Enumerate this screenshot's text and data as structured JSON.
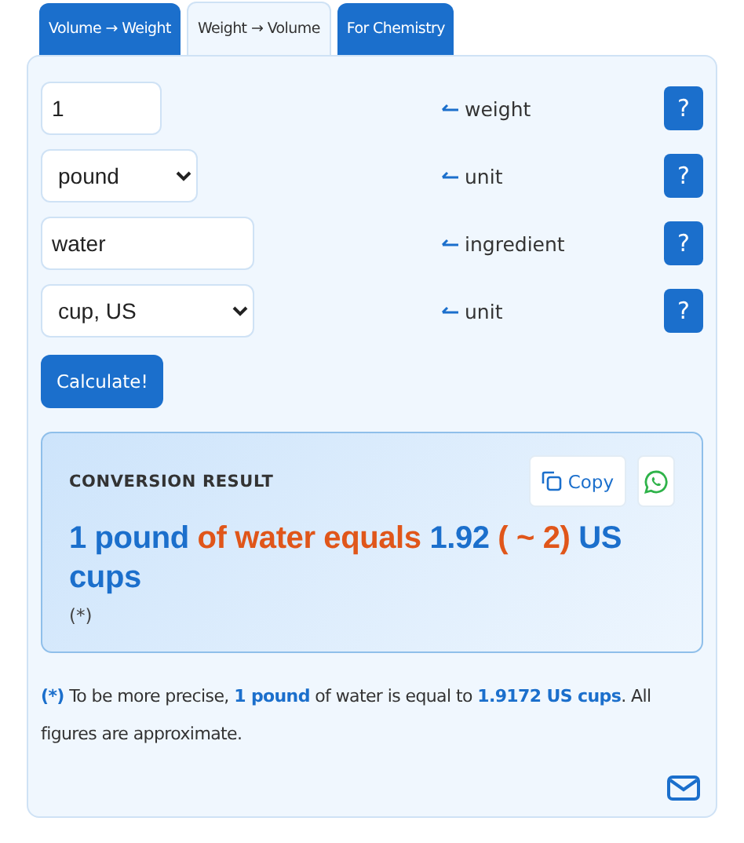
{
  "tabs": [
    {
      "label": "Volume → Weight",
      "selected": false
    },
    {
      "label": "Weight → Volume",
      "selected": true
    },
    {
      "label": "For Chemistry",
      "selected": false
    }
  ],
  "fields": [
    {
      "kind": "input",
      "value": "1",
      "label": "weight",
      "help": "?"
    },
    {
      "kind": "select",
      "value": "pound",
      "label": "unit",
      "help": "?"
    },
    {
      "kind": "input",
      "value": "water",
      "label": "ingredient",
      "help": "?"
    },
    {
      "kind": "select",
      "value": "cup, US",
      "label": "unit",
      "help": "?"
    }
  ],
  "calculate_button": "Calculate!",
  "result": {
    "heading": "CONVERSION RESULT",
    "copy_button": "Copy",
    "sentence": [
      {
        "kind": "value",
        "text": "1 pound"
      },
      {
        "kind": "text",
        "text": " of water equals "
      },
      {
        "kind": "value",
        "text": "1.92"
      },
      {
        "kind": "text",
        "text": " ( ~ 2)"
      },
      {
        "kind": "value",
        "text": " US cups"
      }
    ],
    "note_mark": "(*)"
  },
  "footnote": [
    {
      "kind": "mark",
      "text": "(*)"
    },
    {
      "kind": "text",
      "text": " To be more precise, "
    },
    {
      "kind": "value",
      "text": "1 pound"
    },
    {
      "kind": "text",
      "text": " of water is equal to "
    },
    {
      "kind": "value",
      "text": "1.9172 US cups"
    },
    {
      "kind": "text",
      "text": ". All figures are approximate."
    }
  ]
}
